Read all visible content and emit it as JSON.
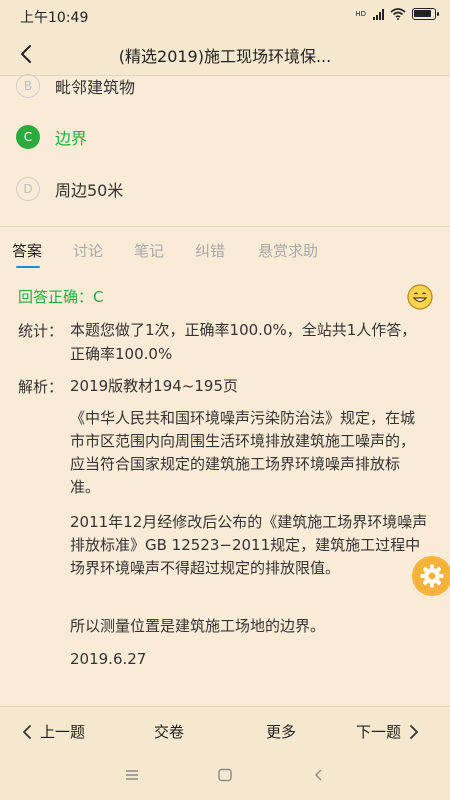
{
  "status_bar": {
    "time": "上午10:49",
    "network": "HD",
    "battery_level": 0.9
  },
  "header": {
    "title": "(精选2019)施工现场环境保..."
  },
  "options": [
    {
      "letter": "B",
      "text": "毗邻建筑物",
      "correct": false
    },
    {
      "letter": "C",
      "text": "边界",
      "correct": true
    },
    {
      "letter": "D",
      "text": "周边50米",
      "correct": false
    }
  ],
  "tabs": [
    {
      "label": "答案",
      "active": true
    },
    {
      "label": "讨论",
      "active": false
    },
    {
      "label": "笔记",
      "active": false
    },
    {
      "label": "纠错",
      "active": false
    },
    {
      "label": "悬赏求助",
      "active": false
    }
  ],
  "answer": {
    "result": "回答正确：C",
    "stats_label": "统计：",
    "stats_text": "本题您做了1次，正确率100.0%，全站共1人作答，正确率100.0%",
    "analysis_label": "解析：",
    "analysis": [
      "2019版教材194~195页",
      "《中华人民共和国环境噪声污染防治法》规定，在城市市区范围内向周围生活环境排放建筑施工噪声的，应当符合国家规定的建筑施工场界环境噪声排放标准。",
      "2011年12月经修改后公布的《建筑施工场界环境噪声排放标准》GB 12523−2011规定，建筑施工过程中场界环境噪声不得超过规定的排放限值。",
      "所以测量位置是建筑施工场地的边界。",
      "2019.6.27"
    ]
  },
  "bottom_nav": {
    "prev": "上一题",
    "submit": "交卷",
    "more": "更多",
    "next": "下一题"
  },
  "icons": {
    "back": "back-arrow-icon",
    "smiley": "smiley-icon",
    "settings": "gear-icon",
    "menu": "menu-icon",
    "home": "home-icon",
    "nav_back": "nav-back-icon"
  },
  "colors": {
    "correct": "#2bab3e",
    "accent": "#1a8fd8",
    "settings_button": "#f7b23b",
    "background": "#faebd7"
  }
}
